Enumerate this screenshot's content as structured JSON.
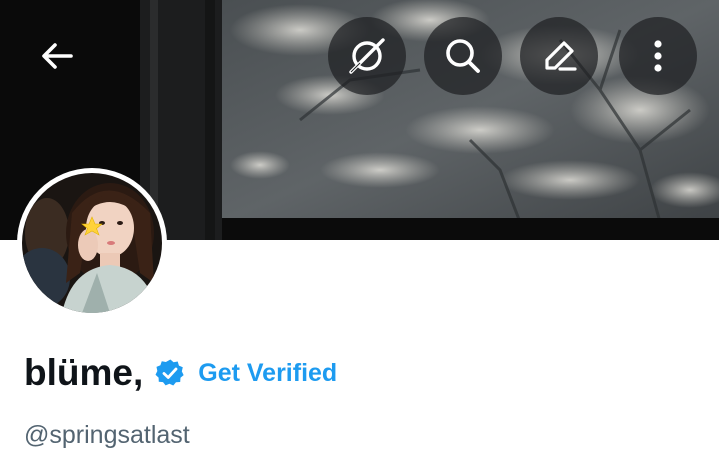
{
  "nav": {
    "back_icon": "arrow-left-icon",
    "actions": [
      {
        "name": "grok-icon",
        "label": "Grok"
      },
      {
        "name": "search-icon",
        "label": "Search"
      },
      {
        "name": "edit-icon",
        "label": "Edit"
      },
      {
        "name": "more-icon",
        "label": "More"
      }
    ]
  },
  "profile": {
    "display_name": "blüme,",
    "get_verified_label": "Get Verified",
    "handle": "@springsatlast"
  },
  "colors": {
    "accent": "#1d9bf0",
    "text_primary": "#0f1419",
    "text_secondary": "#536471",
    "nav_button_bg": "#1e2022"
  }
}
